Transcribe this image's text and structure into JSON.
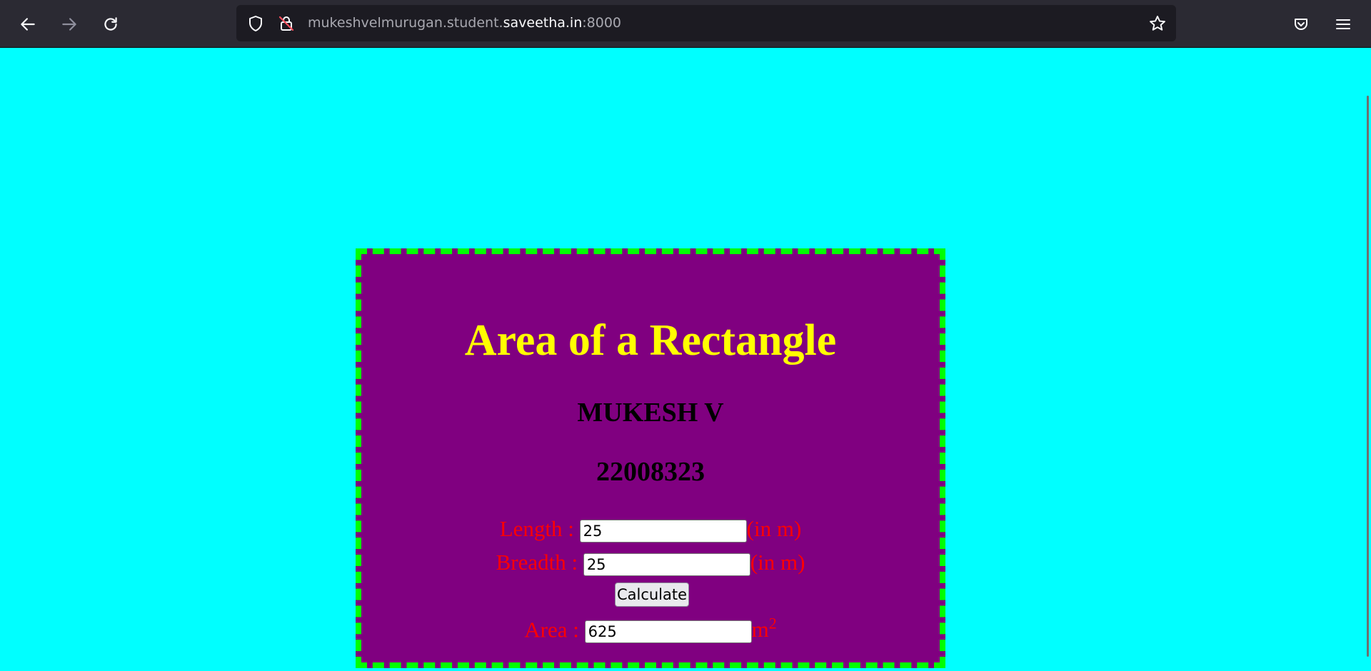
{
  "browser": {
    "url_prefix": "mukeshvelmurugan.student.",
    "url_host": "saveetha.in",
    "url_suffix": ":8000"
  },
  "page": {
    "title": "Area of a Rectangle",
    "name": "MUKESH V",
    "register_number": "22008323",
    "length_label": "Length :",
    "length_value": "25",
    "length_unit": "(in m)",
    "breadth_label": "Breadth :",
    "breadth_value": "25",
    "breadth_unit": "(in m)",
    "calculate_label": "Calculate",
    "area_label": "Area :",
    "area_value": "625",
    "area_unit": "m",
    "area_unit_exponent": "2"
  },
  "colors": {
    "background": "#00ffff",
    "card": "#800080",
    "border": "#00ff00",
    "title": "#ffff00",
    "labels": "#ff0000"
  },
  "icons": [
    "back-arrow-icon",
    "forward-arrow-icon",
    "reload-icon",
    "shield-icon",
    "insecure-lock-icon",
    "bookmark-star-icon",
    "pocket-icon",
    "menu-icon"
  ]
}
